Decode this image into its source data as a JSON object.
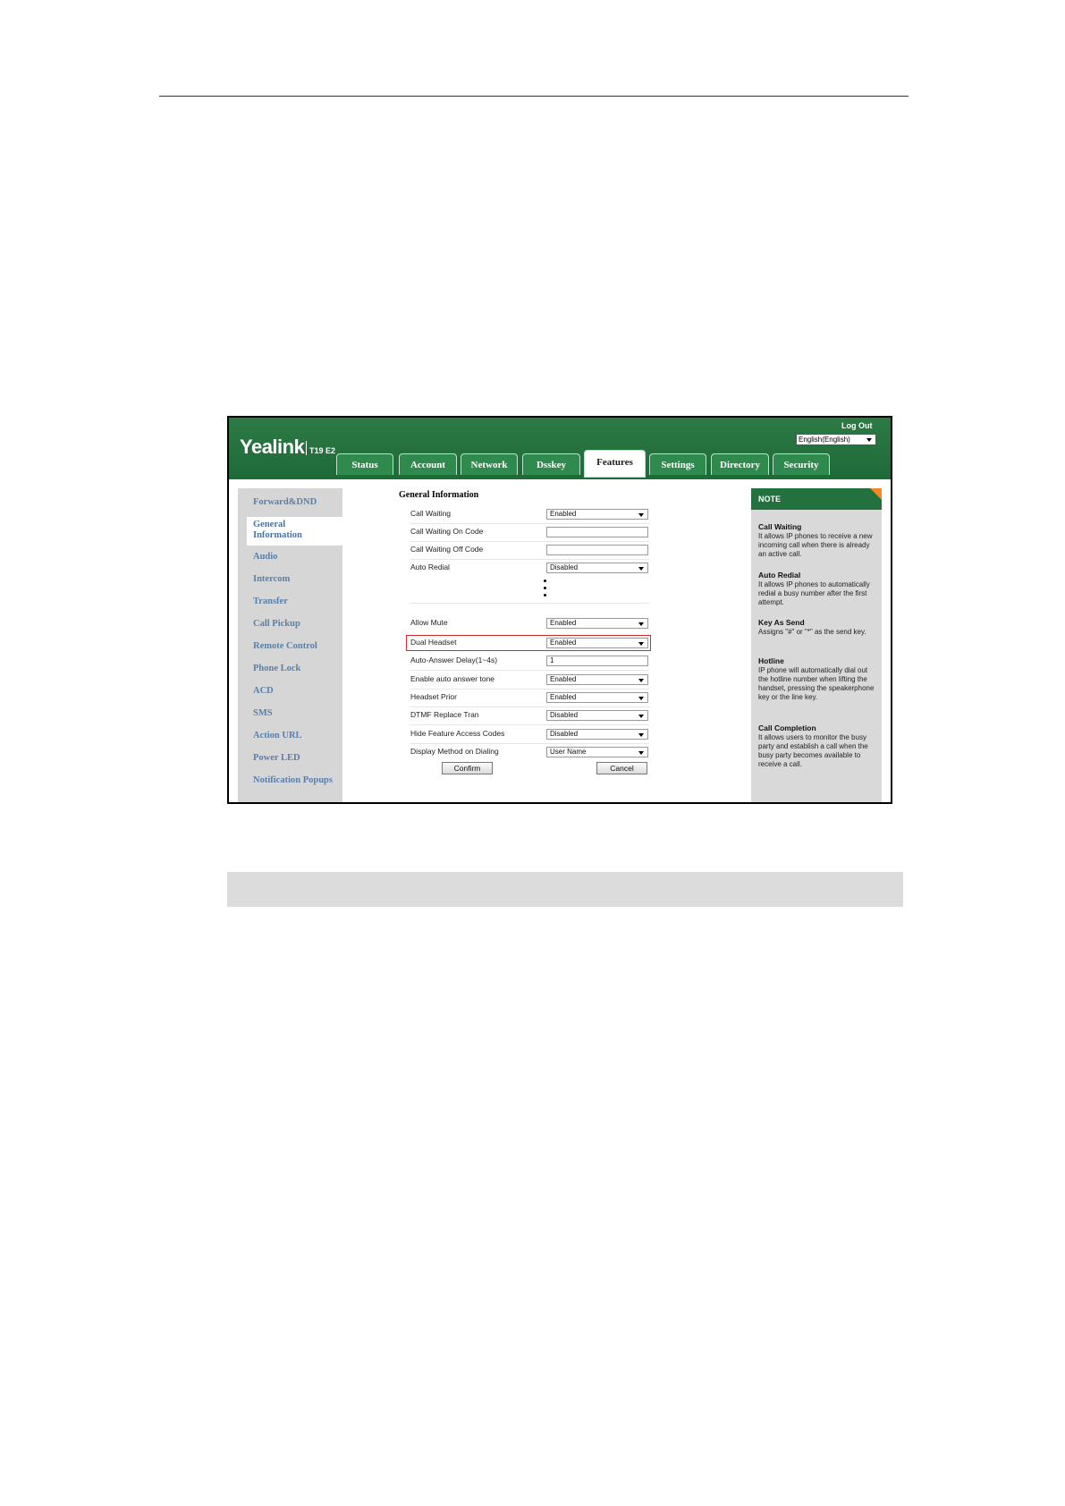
{
  "window": {
    "logo": "Yealink",
    "model": "T19 E2",
    "logout": "Log Out",
    "language": "English(English)"
  },
  "tabs": [
    {
      "label": "Status"
    },
    {
      "label": "Account"
    },
    {
      "label": "Network"
    },
    {
      "label": "Dsskey"
    },
    {
      "label": "Features",
      "active": true
    },
    {
      "label": "Settings"
    },
    {
      "label": "Directory"
    },
    {
      "label": "Security"
    }
  ],
  "sidebar": {
    "items": [
      {
        "label": "Forward&DND"
      },
      {
        "label": "General Information",
        "active": true
      },
      {
        "label": "Audio"
      },
      {
        "label": "Intercom"
      },
      {
        "label": "Transfer"
      },
      {
        "label": "Call Pickup"
      },
      {
        "label": "Remote Control"
      },
      {
        "label": "Phone Lock"
      },
      {
        "label": "ACD"
      },
      {
        "label": "SMS"
      },
      {
        "label": "Action URL"
      },
      {
        "label": "Power LED"
      },
      {
        "label": "Notification Popups"
      }
    ]
  },
  "main": {
    "section_title": "General Information",
    "rows": [
      {
        "label": "Call Waiting",
        "type": "select",
        "value": "Enabled"
      },
      {
        "label": "Call Waiting On Code",
        "type": "text",
        "value": ""
      },
      {
        "label": "Call Waiting Off Code",
        "type": "text",
        "value": ""
      },
      {
        "label": "Auto Redial",
        "type": "select",
        "value": "Disabled"
      },
      {
        "label": "Allow Mute",
        "type": "select",
        "value": "Enabled"
      },
      {
        "label": "Dual Headset",
        "type": "select",
        "value": "Enabled",
        "highlighted": true
      },
      {
        "label": "Auto-Answer Delay(1~4s)",
        "type": "text",
        "value": "1"
      },
      {
        "label": "Enable auto answer tone",
        "type": "select",
        "value": "Enabled"
      },
      {
        "label": "Headset Prior",
        "type": "select",
        "value": "Enabled"
      },
      {
        "label": "DTMF Replace Tran",
        "type": "select",
        "value": "Disabled"
      },
      {
        "label": "Hide Feature Access Codes",
        "type": "select",
        "value": "Disabled"
      },
      {
        "label": "Display Method on Dialing",
        "type": "select",
        "value": "User Name"
      }
    ],
    "confirm_label": "Confirm",
    "cancel_label": "Cancel"
  },
  "note": {
    "header": "NOTE",
    "entries": [
      {
        "title": "Call Waiting",
        "body": "It allows IP phones to receive a new incoming call when there is already an active call."
      },
      {
        "title": "Auto Redial",
        "body": "It allows IP phones to automatically redial a busy number after the first attempt."
      },
      {
        "title": "Key As Send",
        "body": "Assigns \"#\" or \"*\" as the send key."
      },
      {
        "title": "Hotline",
        "body": "IP phone will automatically dial out the hotline number when lifting the handset, pressing the speakerphone key or the line key."
      },
      {
        "title": "Call Completion",
        "body": "It allows users to monitor the busy party and establish a call when the busy party becomes available to receive a call."
      }
    ]
  },
  "colors": {
    "header_green": "#1f6a39",
    "tab_green": "#2e8b4d",
    "highlight_red": "#d12c2c",
    "note_corner": "#f08a24",
    "sidebar_link": "#5a7fa8"
  }
}
